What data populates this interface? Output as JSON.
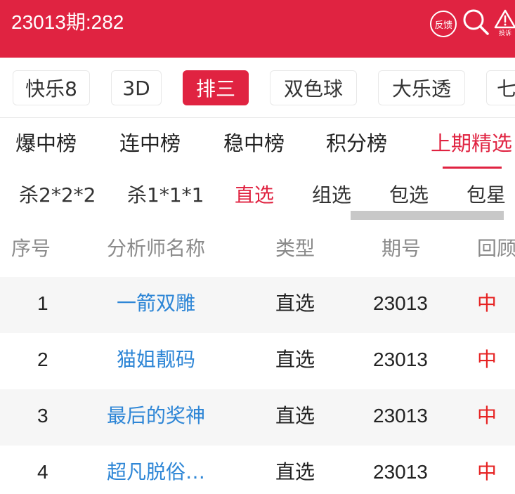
{
  "header": {
    "title": "23013期:282",
    "feedback_label": "反馈",
    "complain_label": "投诉"
  },
  "lottery_tabs": [
    "快乐8",
    "3D",
    "排三",
    "双色球",
    "大乐透",
    "七"
  ],
  "lottery_active_index": 2,
  "rank_tabs": [
    "爆中榜",
    "连中榜",
    "稳中榜",
    "积分榜",
    "上期精选"
  ],
  "rank_active_index": 4,
  "filter_tabs": [
    "杀2*2*2",
    "杀1*1*1",
    "直选",
    "组选",
    "包选",
    "包星"
  ],
  "filter_active_index": 2,
  "table": {
    "headers": [
      "序号",
      "分析师名称",
      "类型",
      "期号",
      "回顾"
    ],
    "rows": [
      {
        "no": "1",
        "name": "一箭双雕",
        "type": "直选",
        "issue": "23013",
        "result": "中"
      },
      {
        "no": "2",
        "name": "猫姐靓码",
        "type": "直选",
        "issue": "23013",
        "result": "中"
      },
      {
        "no": "3",
        "name": "最后的奖神",
        "type": "直选",
        "issue": "23013",
        "result": "中"
      },
      {
        "no": "4",
        "name": "超凡脱俗…",
        "type": "直选",
        "issue": "23013",
        "result": "中"
      }
    ]
  },
  "colors": {
    "brand_red": "#e02341",
    "link_blue": "#2e86d6",
    "hit_red": "#e62323"
  }
}
